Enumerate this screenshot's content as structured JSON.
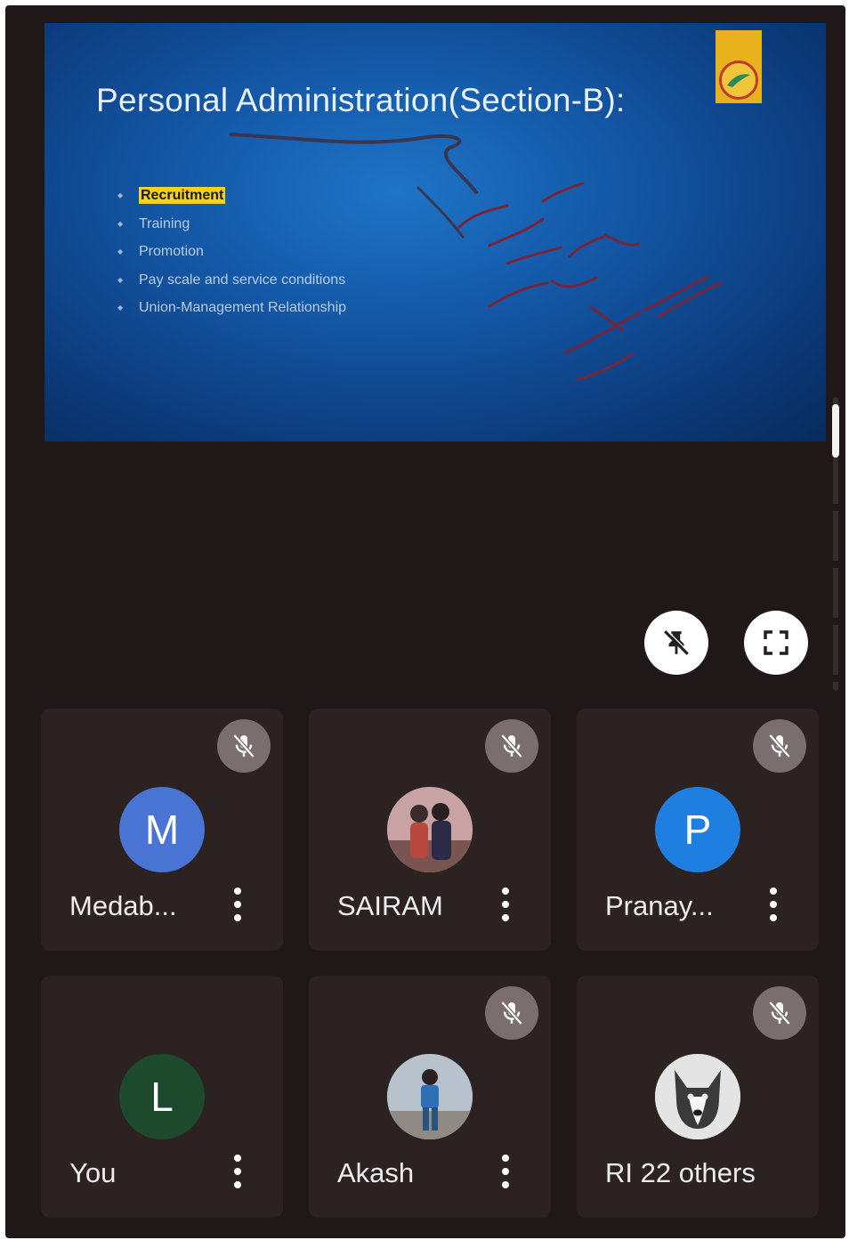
{
  "presentation": {
    "title": "Personal Administration(Section-B):",
    "bullets": [
      "Recruitment",
      "Training",
      "Promotion",
      "Pay scale and service conditions",
      "Union-Management Relationship"
    ],
    "highlighted_bullet": "Recruitment",
    "background_color": "#1459a8",
    "annotation_color": "#7a2438"
  },
  "controls": {
    "unpin_icon": "unpin-icon",
    "fullscreen_icon": "fullscreen-icon"
  },
  "participants": [
    {
      "name": "Medab...",
      "avatar_type": "initial",
      "initial": "M",
      "avatar_color": "#4a74d4",
      "muted": true
    },
    {
      "name": "SAIRAM",
      "avatar_type": "photo",
      "muted": true
    },
    {
      "name": "Pranay...",
      "avatar_type": "initial",
      "initial": "P",
      "avatar_color": "#1f7fe0",
      "muted": true
    },
    {
      "name": "You",
      "avatar_type": "initial",
      "initial": "L",
      "avatar_color": "#1d4a2c",
      "muted": false
    },
    {
      "name": "Akash",
      "avatar_type": "photo",
      "muted": true
    },
    {
      "name": "RI 22 others",
      "avatar_type": "photo",
      "muted": true
    }
  ],
  "colors": {
    "screen_bg": "#1f1718",
    "tile_bg": "#2d2222",
    "mic_off_bg": "#7a6e6e"
  }
}
